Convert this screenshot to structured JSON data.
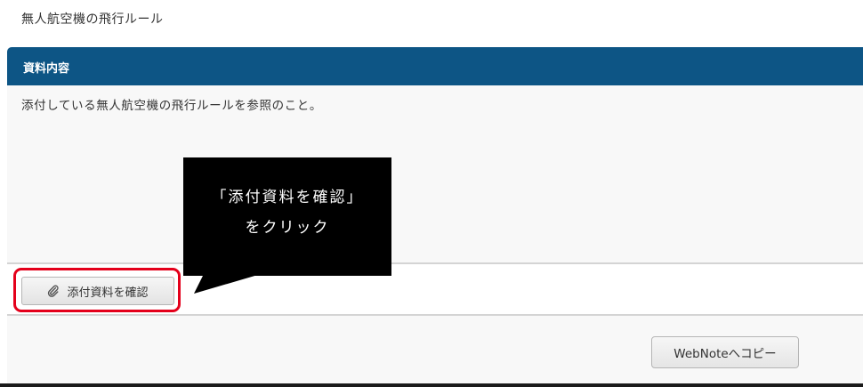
{
  "document": {
    "title": "無人航空機の飛行ルール"
  },
  "section": {
    "header_label": "資料内容",
    "description": "添付している無人航空機の飛行ルールを参照のこと。"
  },
  "attachment": {
    "button_label": "添付資料を確認",
    "icon": "paperclip-icon"
  },
  "callout": {
    "line1": "「添付資料を確認」",
    "line2": "をクリック"
  },
  "footer": {
    "webnote_button_label": "WebNoteへコピー"
  },
  "colors": {
    "header_bg": "#0d5585",
    "highlight": "#e4001b",
    "callout_bg": "#000000"
  }
}
